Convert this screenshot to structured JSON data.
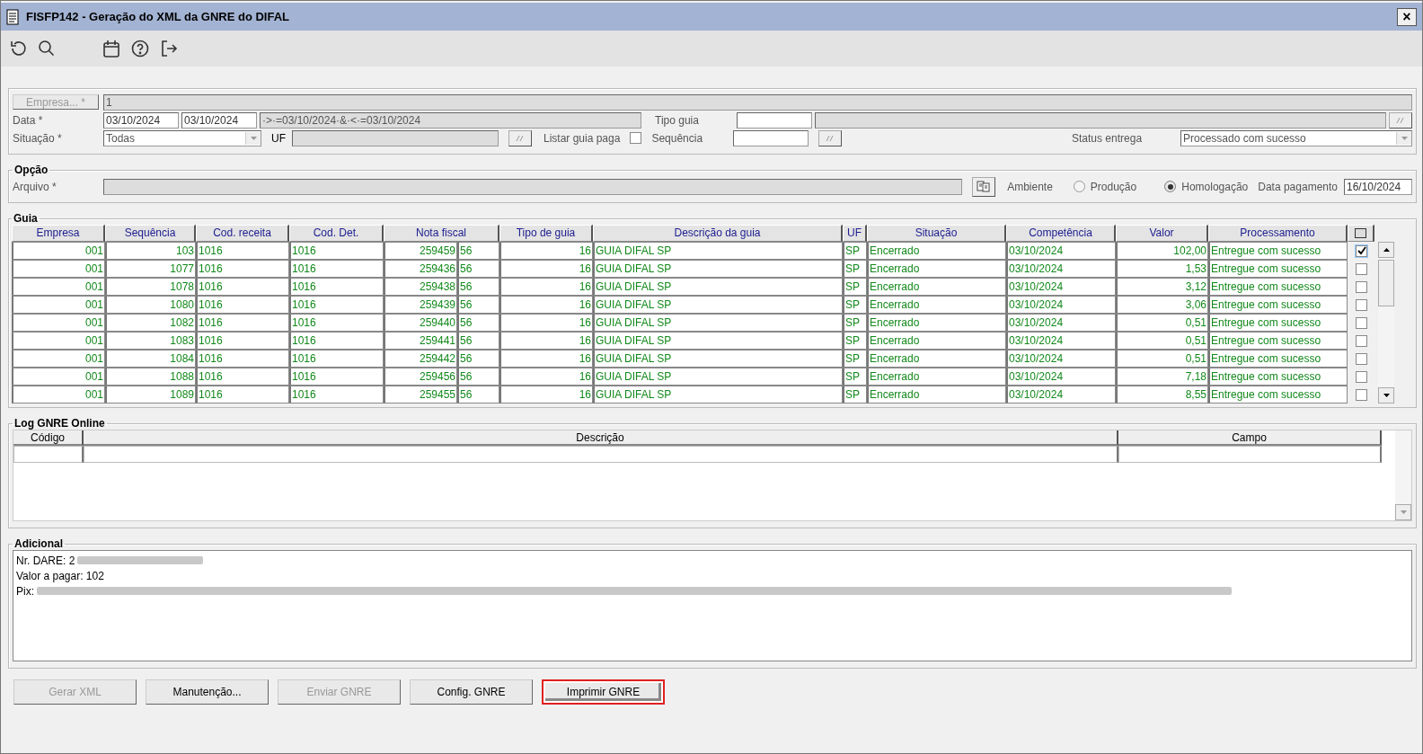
{
  "window": {
    "title": "FISFP142 - Geração do XML da GNRE do DIFAL",
    "close": "×"
  },
  "filters": {
    "empresa": {
      "label": "Empresa... *",
      "disabled": true,
      "value": "1"
    },
    "data": {
      "label": "Data *",
      "from": "03/10/2024",
      "to": "03/10/2024",
      "expression": "·>·=03/10/2024·&·<·=03/10/2024"
    },
    "tipo_guia": {
      "label": "Tipo guia"
    },
    "situacao": {
      "label": "Situação *",
      "value": "Todas"
    },
    "uf": {
      "label": "UF"
    },
    "listar_guia_paga": {
      "label": "Listar guia paga",
      "checked": false
    },
    "sequencia": {
      "label": "Sequência"
    },
    "status_entrega": {
      "label": "Status entrega",
      "value": "Processado com sucesso"
    }
  },
  "opcao": {
    "title": "Opção",
    "arquivo": {
      "label": "Arquivo *"
    },
    "ambiente": {
      "label": "Ambiente"
    },
    "radios": [
      {
        "label": "Produção",
        "selected": false
      },
      {
        "label": "Homologação",
        "selected": true
      }
    ],
    "data_pagamento": {
      "label": "Data pagamento",
      "value": "16/10/2024"
    }
  },
  "guia": {
    "title": "Guia",
    "columns": [
      "Empresa",
      "Sequência",
      "Cod. receita",
      "Cod. Det.",
      "Nota fiscal",
      "",
      "Tipo de guia",
      "Descrição da guia",
      "UF",
      "Situação",
      "Competência",
      "Valor",
      "Processamento"
    ],
    "rows": [
      {
        "cells": [
          "001",
          "103",
          "1016",
          "1016",
          "259459",
          "56",
          "16",
          "GUIA DIFAL SP",
          "SP",
          "Encerrado",
          "03/10/2024",
          "102,00",
          "Entregue com sucesso"
        ],
        "checked": true
      },
      {
        "cells": [
          "001",
          "1077",
          "1016",
          "1016",
          "259436",
          "56",
          "16",
          "GUIA DIFAL SP",
          "SP",
          "Encerrado",
          "03/10/2024",
          "1,53",
          "Entregue com sucesso"
        ],
        "checked": false
      },
      {
        "cells": [
          "001",
          "1078",
          "1016",
          "1016",
          "259438",
          "56",
          "16",
          "GUIA DIFAL SP",
          "SP",
          "Encerrado",
          "03/10/2024",
          "3,12",
          "Entregue com sucesso"
        ],
        "checked": false
      },
      {
        "cells": [
          "001",
          "1080",
          "1016",
          "1016",
          "259439",
          "56",
          "16",
          "GUIA DIFAL SP",
          "SP",
          "Encerrado",
          "03/10/2024",
          "3,06",
          "Entregue com sucesso"
        ],
        "checked": false
      },
      {
        "cells": [
          "001",
          "1082",
          "1016",
          "1016",
          "259440",
          "56",
          "16",
          "GUIA DIFAL SP",
          "SP",
          "Encerrado",
          "03/10/2024",
          "0,51",
          "Entregue com sucesso"
        ],
        "checked": false
      },
      {
        "cells": [
          "001",
          "1083",
          "1016",
          "1016",
          "259441",
          "56",
          "16",
          "GUIA DIFAL SP",
          "SP",
          "Encerrado",
          "03/10/2024",
          "0,51",
          "Entregue com sucesso"
        ],
        "checked": false
      },
      {
        "cells": [
          "001",
          "1084",
          "1016",
          "1016",
          "259442",
          "56",
          "16",
          "GUIA DIFAL SP",
          "SP",
          "Encerrado",
          "03/10/2024",
          "0,51",
          "Entregue com sucesso"
        ],
        "checked": false
      },
      {
        "cells": [
          "001",
          "1088",
          "1016",
          "1016",
          "259456",
          "56",
          "16",
          "GUIA DIFAL SP",
          "SP",
          "Encerrado",
          "03/10/2024",
          "7,18",
          "Entregue com sucesso"
        ],
        "checked": false
      },
      {
        "cells": [
          "001",
          "1089",
          "1016",
          "1016",
          "259455",
          "56",
          "16",
          "GUIA DIFAL SP",
          "SP",
          "Encerrado",
          "03/10/2024",
          "8,55",
          "Entregue com sucesso"
        ],
        "checked": false
      }
    ]
  },
  "log": {
    "title": "Log GNRE Online",
    "columns": [
      "Código",
      "Descrição",
      "Campo"
    ]
  },
  "adicional": {
    "title": "Adicional",
    "lines": [
      {
        "text": "Nr. DARE: 2",
        "redacted": true
      },
      {
        "text": "Valor a pagar: 102",
        "redacted": false
      },
      {
        "text": "Pix:",
        "redacted": true
      }
    ]
  },
  "buttons": [
    {
      "label": "Gerar XML",
      "disabled": true,
      "highlighted": false
    },
    {
      "label": "Manutenção...",
      "disabled": false,
      "highlighted": false
    },
    {
      "label": "Enviar GNRE",
      "disabled": true,
      "highlighted": false
    },
    {
      "label": "Config. GNRE",
      "disabled": false,
      "highlighted": false
    },
    {
      "label": "Imprimir GNRE",
      "disabled": false,
      "highlighted": true
    }
  ]
}
